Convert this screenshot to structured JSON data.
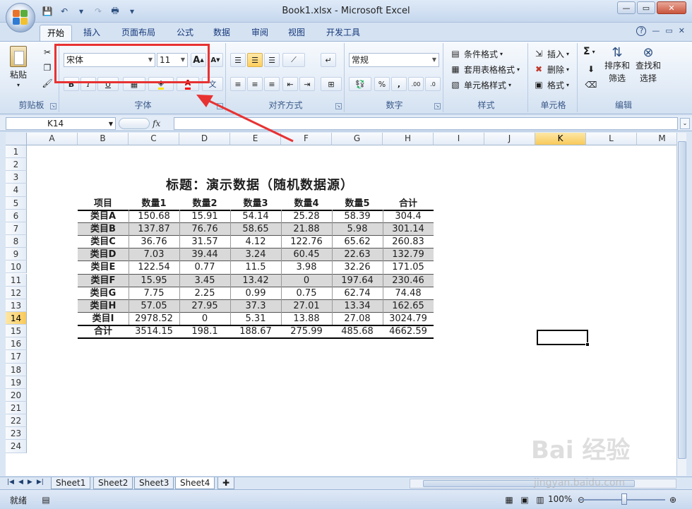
{
  "window": {
    "title": "Book1.xlsx - Microsoft Excel",
    "controls": {
      "minimize": "—",
      "maximize": "▭",
      "close": "✕"
    }
  },
  "qat": {
    "save_icon": "💾",
    "undo_icon": "↶",
    "redo_icon": "↷",
    "print_icon": "🖶",
    "more": "▾"
  },
  "tabs": [
    "开始",
    "插入",
    "页面布局",
    "公式",
    "数据",
    "审阅",
    "视图",
    "开发工具"
  ],
  "tab_right": {
    "help": "?",
    "minimize": "—",
    "restore": "▭",
    "close": "✕"
  },
  "ribbon": {
    "clipboard": {
      "paste_label": "粘贴",
      "group_label": "剪贴板"
    },
    "font": {
      "font_name": "宋体",
      "font_size": "11",
      "grow": "A",
      "shrink": "A",
      "bold": "B",
      "italic": "I",
      "underline": "U",
      "wen": "文",
      "group_label": "字体"
    },
    "alignment": {
      "group_label": "对齐方式"
    },
    "number": {
      "format": "常规",
      "percent": "%",
      "comma": ",",
      "inc_decimal": ".00",
      "dec_decimal": ".0",
      "group_label": "数字"
    },
    "styles": {
      "conditional": "条件格式",
      "table_format": "套用表格格式",
      "cell_style": "单元格样式",
      "group_label": "样式"
    },
    "cells": {
      "insert": "插入",
      "delete": "删除",
      "format": "格式",
      "group_label": "单元格"
    },
    "editing": {
      "sum": "Σ",
      "sort_top": "排序和",
      "sort_bottom": "筛选",
      "find_top": "查找和",
      "find_bottom": "选择",
      "group_label": "编辑"
    }
  },
  "formula_bar": {
    "name_box": "K14",
    "fx": "fx",
    "value": ""
  },
  "columns": [
    "A",
    "B",
    "C",
    "D",
    "E",
    "F",
    "G",
    "H",
    "I",
    "J",
    "K",
    "L",
    "M"
  ],
  "active_column": "K",
  "rows": [
    "1",
    "2",
    "3",
    "4",
    "5",
    "6",
    "7",
    "8",
    "9",
    "10",
    "11",
    "12",
    "13",
    "14",
    "15",
    "16",
    "17",
    "18",
    "19",
    "20",
    "21",
    "22",
    "23",
    "24"
  ],
  "active_row": "14",
  "table": {
    "title": "标题：演示数据（随机数据源）",
    "headers": [
      "项目",
      "数量1",
      "数量2",
      "数量3",
      "数量4",
      "数量5",
      "合计"
    ],
    "rows": [
      [
        "类目A",
        "150.68",
        "15.91",
        "54.14",
        "25.28",
        "58.39",
        "304.4"
      ],
      [
        "类目B",
        "137.87",
        "76.76",
        "58.65",
        "21.88",
        "5.98",
        "301.14"
      ],
      [
        "类目C",
        "36.76",
        "31.57",
        "4.12",
        "122.76",
        "65.62",
        "260.83"
      ],
      [
        "类目D",
        "7.03",
        "39.44",
        "3.24",
        "60.45",
        "22.63",
        "132.79"
      ],
      [
        "类目E",
        "122.54",
        "0.77",
        "11.5",
        "3.98",
        "32.26",
        "171.05"
      ],
      [
        "类目F",
        "15.95",
        "3.45",
        "13.42",
        "0",
        "197.64",
        "230.46"
      ],
      [
        "类目G",
        "7.75",
        "2.25",
        "0.99",
        "0.75",
        "62.74",
        "74.48"
      ],
      [
        "类目H",
        "57.05",
        "27.95",
        "37.3",
        "27.01",
        "13.34",
        "162.65"
      ],
      [
        "类目I",
        "2978.52",
        "0",
        "5.31",
        "13.88",
        "27.08",
        "3024.79"
      ]
    ],
    "total": [
      "合计",
      "3514.15",
      "198.1",
      "188.67",
      "275.99",
      "485.68",
      "4662.59"
    ]
  },
  "sheet_tabs": [
    "Sheet1",
    "Sheet2",
    "Sheet3",
    "Sheet4"
  ],
  "active_sheet": "Sheet4",
  "status": {
    "ready": "就绪",
    "zoom": "100%",
    "zoom_fraction": 0.5
  },
  "watermark": {
    "brand": "Bai 经验",
    "url": "jingyan.baidu.com"
  },
  "colors": {
    "highlight_box": "#e83232",
    "active_header": "#f8c95a",
    "stripe": "#d9d9d9"
  }
}
